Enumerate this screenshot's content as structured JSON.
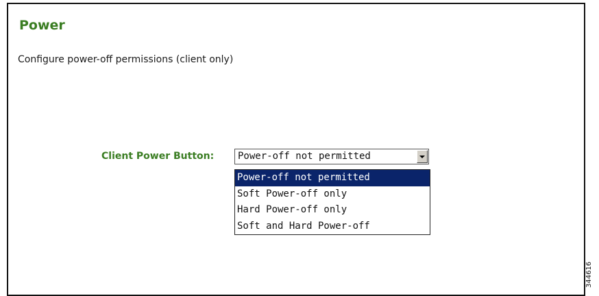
{
  "page": {
    "title": "Power",
    "description": "Configure power-off permissions (client only)",
    "side_id": "344616"
  },
  "power_button": {
    "label": "Client Power Button:",
    "selected": "Power-off not permitted",
    "options": [
      "Power-off not permitted",
      "Soft Power-off only",
      "Hard Power-off only",
      "Soft and Hard Power-off"
    ],
    "highlighted_index": 0
  },
  "colors": {
    "heading": "#3a7d22",
    "highlight": "#0a246a"
  }
}
